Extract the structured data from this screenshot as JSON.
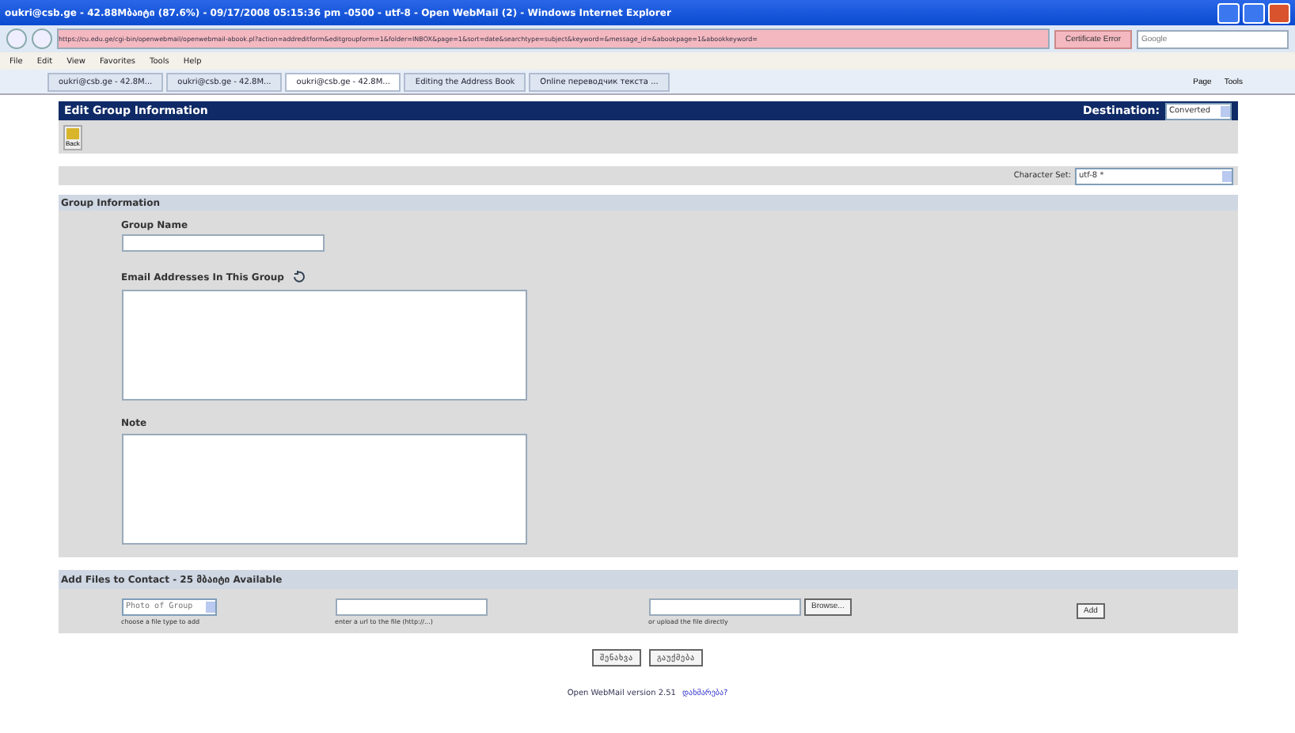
{
  "window": {
    "title": "oukri@csb.ge - 42.88Mბაიტი (87.6%) - 09/17/2008 05:15:36 pm -0500 - utf-8 - Open WebMail (2) - Windows Internet Explorer"
  },
  "address_bar": {
    "url": "https://cu.edu.ge/cgi-bin/openwebmail/openwebmail-abook.pl?action=addreditform&editgroupform=1&folder=INBOX&page=1&sort=date&searchtype=subject&keyword=&message_id=&abookpage=1&abookkeyword=",
    "certificate": "Certificate Error",
    "search_placeholder": "Google"
  },
  "menu": [
    "File",
    "Edit",
    "View",
    "Favorites",
    "Tools",
    "Help"
  ],
  "tabs": [
    {
      "label": "oukri@csb.ge - 42.8M...",
      "selected": false
    },
    {
      "label": "oukri@csb.ge - 42.8M...",
      "selected": false
    },
    {
      "label": "oukri@csb.ge - 42.8M...",
      "selected": true
    },
    {
      "label": "Editing the Address Book",
      "selected": false
    },
    {
      "label": "Online переводчик текста ...",
      "selected": false
    }
  ],
  "command_bar": [
    "Page",
    "Tools"
  ],
  "page": {
    "heading": "Edit Group Information",
    "destination_label": "Destination:",
    "destination_value": "Converted",
    "back_label": "Back",
    "charset_label": "Character Set:",
    "charset_value": "utf-8 *",
    "section": "Group Information",
    "group_name_label": "Group Name",
    "emails_label": "Email Addresses In This Group",
    "note_label": "Note",
    "files_heading": "Add Files to Contact - 25 მბაიტი Available",
    "file_type_value": "Photo of Group",
    "file_type_hint": "choose a file type to add",
    "url_hint": "enter a url to the file (http://...)",
    "upload_hint": "or upload the file directly",
    "browse": "Browse...",
    "add": "Add",
    "save": "შენახვა",
    "cancel": "გაუქმება",
    "footer": "Open WebMail version 2.51",
    "footer_link": "დახმარება?"
  }
}
